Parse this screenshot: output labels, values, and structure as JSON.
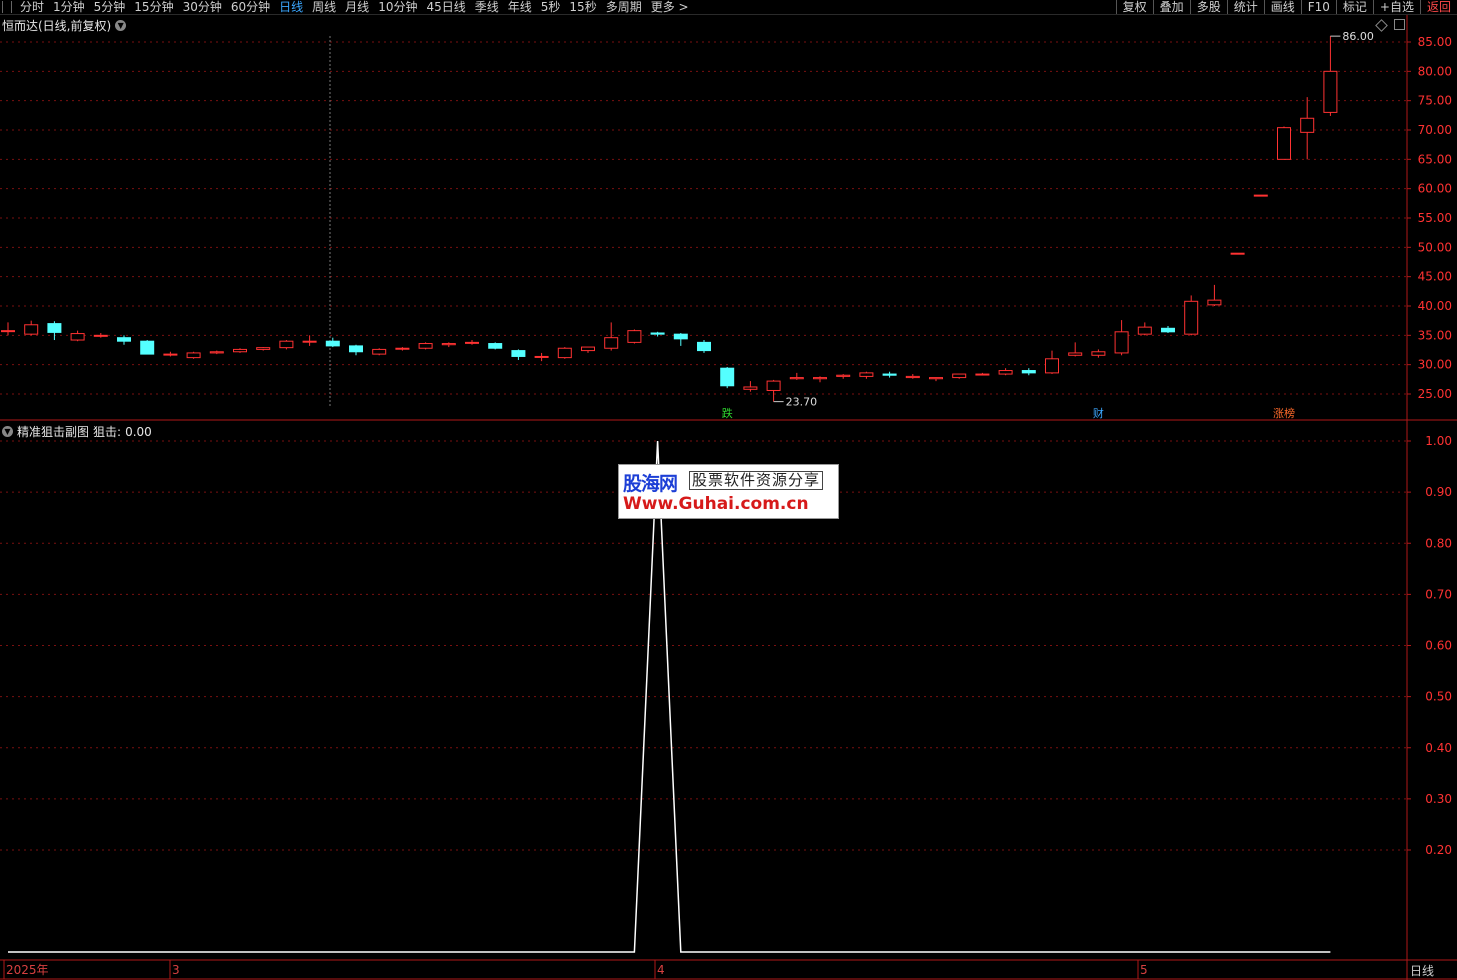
{
  "toolbar": {
    "periods": [
      "分时",
      "1分钟",
      "5分钟",
      "15分钟",
      "30分钟",
      "60分钟",
      "日线",
      "周线",
      "月线",
      "10分钟",
      "45日线",
      "季线",
      "年线",
      "5秒",
      "15秒",
      "多周期",
      "更多 >"
    ],
    "active_period": "日线",
    "right_buttons": [
      "复权",
      "叠加",
      "多股",
      "统计",
      "画线",
      "F10",
      "标记",
      "+自选",
      "返回"
    ]
  },
  "main_chart": {
    "title": "恒而达(日线,前复权)",
    "price_axis": [
      "85.00",
      "80.00",
      "75.00",
      "70.00",
      "65.00",
      "60.00",
      "55.00",
      "50.00",
      "45.00",
      "40.00",
      "35.00",
      "30.00",
      "25.00"
    ],
    "high_label": "86.00",
    "low_label": "23.70",
    "markers": [
      {
        "text": "跌",
        "color": "#2fd62f"
      },
      {
        "text": "财",
        "color": "#3ba7ff"
      },
      {
        "text": "涨榜",
        "color": "#ff6a2a"
      }
    ]
  },
  "sub_chart": {
    "title": "精准狙击副图",
    "series_label": "狙击:",
    "series_value": "0.00",
    "value_axis": [
      "1.00",
      "0.90",
      "0.80",
      "0.70",
      "0.60",
      "0.50",
      "0.40",
      "0.30",
      "0.20"
    ]
  },
  "time_axis": {
    "labels": [
      "2025年",
      "3",
      "4",
      "5"
    ]
  },
  "period_badge": "日线",
  "watermark": {
    "brand": "股海网",
    "tagline": "股票软件资源分享",
    "url": "Www.Guhai.com.cn"
  },
  "colors": {
    "up": "#ff3232",
    "down": "#54ffff",
    "grid": "#7a1010",
    "axis": "#b01818",
    "line": "#ffffff"
  },
  "chart_data": [
    {
      "type": "candlestick",
      "title": "恒而达(日线,前复权)",
      "ylim": [
        21.5,
        88
      ],
      "candles": [
        {
          "o": 35.8,
          "h": 37.2,
          "l": 35.0,
          "c": 35.8
        },
        {
          "o": 35.2,
          "h": 37.5,
          "l": 35.0,
          "c": 36.8
        },
        {
          "o": 37.0,
          "h": 37.4,
          "l": 34.2,
          "c": 35.5
        },
        {
          "o": 34.2,
          "h": 35.8,
          "l": 34.0,
          "c": 35.3
        },
        {
          "o": 35.0,
          "h": 35.4,
          "l": 34.6,
          "c": 35.0
        },
        {
          "o": 34.6,
          "h": 35.0,
          "l": 33.4,
          "c": 34.0
        },
        {
          "o": 34.0,
          "h": 34.2,
          "l": 31.8,
          "c": 31.8
        },
        {
          "o": 31.8,
          "h": 32.2,
          "l": 31.4,
          "c": 31.8
        },
        {
          "o": 31.2,
          "h": 32.2,
          "l": 31.0,
          "c": 32.0
        },
        {
          "o": 32.0,
          "h": 32.4,
          "l": 31.8,
          "c": 32.2
        },
        {
          "o": 32.2,
          "h": 32.8,
          "l": 32.0,
          "c": 32.6
        },
        {
          "o": 32.6,
          "h": 33.0,
          "l": 32.4,
          "c": 32.9
        },
        {
          "o": 32.9,
          "h": 34.2,
          "l": 32.6,
          "c": 34.0
        },
        {
          "o": 34.0,
          "h": 35.0,
          "l": 33.2,
          "c": 34.0
        },
        {
          "o": 34.0,
          "h": 34.6,
          "l": 33.0,
          "c": 33.2
        },
        {
          "o": 33.2,
          "h": 33.4,
          "l": 31.6,
          "c": 32.2
        },
        {
          "o": 31.8,
          "h": 32.8,
          "l": 31.6,
          "c": 32.6
        },
        {
          "o": 32.8,
          "h": 33.0,
          "l": 32.4,
          "c": 32.8
        },
        {
          "o": 32.8,
          "h": 33.8,
          "l": 32.6,
          "c": 33.6
        },
        {
          "o": 33.4,
          "h": 33.8,
          "l": 33.0,
          "c": 33.6
        },
        {
          "o": 33.8,
          "h": 34.2,
          "l": 33.4,
          "c": 33.8
        },
        {
          "o": 33.6,
          "h": 33.8,
          "l": 32.6,
          "c": 32.8
        },
        {
          "o": 32.4,
          "h": 32.6,
          "l": 30.8,
          "c": 31.4
        },
        {
          "o": 31.4,
          "h": 32.0,
          "l": 30.6,
          "c": 31.4
        },
        {
          "o": 31.2,
          "h": 33.0,
          "l": 31.0,
          "c": 32.8
        },
        {
          "o": 32.4,
          "h": 33.0,
          "l": 32.0,
          "c": 33.0
        },
        {
          "o": 32.8,
          "h": 37.2,
          "l": 32.4,
          "c": 34.6
        },
        {
          "o": 33.8,
          "h": 36.0,
          "l": 33.6,
          "c": 35.8
        },
        {
          "o": 35.4,
          "h": 35.6,
          "l": 34.8,
          "c": 35.2
        },
        {
          "o": 35.2,
          "h": 35.4,
          "l": 33.2,
          "c": 34.4
        },
        {
          "o": 33.8,
          "h": 34.2,
          "l": 32.0,
          "c": 32.4
        },
        {
          "o": 29.4,
          "h": 29.6,
          "l": 26.0,
          "c": 26.4
        },
        {
          "o": 25.8,
          "h": 27.2,
          "l": 25.4,
          "c": 26.2
        },
        {
          "o": 25.6,
          "h": 27.4,
          "l": 23.7,
          "c": 27.2
        },
        {
          "o": 27.6,
          "h": 28.6,
          "l": 27.4,
          "c": 27.8
        },
        {
          "o": 27.6,
          "h": 28.0,
          "l": 27.0,
          "c": 27.8
        },
        {
          "o": 28.0,
          "h": 28.4,
          "l": 27.6,
          "c": 28.2
        },
        {
          "o": 28.0,
          "h": 28.8,
          "l": 27.6,
          "c": 28.6
        },
        {
          "o": 28.4,
          "h": 28.8,
          "l": 27.8,
          "c": 28.2
        },
        {
          "o": 27.8,
          "h": 28.4,
          "l": 27.6,
          "c": 28.0
        },
        {
          "o": 27.6,
          "h": 27.8,
          "l": 27.2,
          "c": 27.8
        },
        {
          "o": 27.8,
          "h": 28.4,
          "l": 27.6,
          "c": 28.4
        },
        {
          "o": 28.4,
          "h": 28.6,
          "l": 28.2,
          "c": 28.4
        },
        {
          "o": 28.4,
          "h": 29.4,
          "l": 28.2,
          "c": 29.0
        },
        {
          "o": 29.0,
          "h": 29.4,
          "l": 28.2,
          "c": 28.6
        },
        {
          "o": 28.6,
          "h": 32.4,
          "l": 28.4,
          "c": 31.0
        },
        {
          "o": 31.6,
          "h": 33.8,
          "l": 31.4,
          "c": 32.0
        },
        {
          "o": 31.6,
          "h": 32.6,
          "l": 31.2,
          "c": 32.2
        },
        {
          "o": 32.0,
          "h": 37.6,
          "l": 31.6,
          "c": 35.6
        },
        {
          "o": 35.2,
          "h": 37.2,
          "l": 35.0,
          "c": 36.4
        },
        {
          "o": 36.2,
          "h": 36.6,
          "l": 35.4,
          "c": 35.6
        },
        {
          "o": 35.2,
          "h": 41.8,
          "l": 35.0,
          "c": 40.8
        },
        {
          "o": 40.2,
          "h": 43.6,
          "l": 40.0,
          "c": 41.0
        },
        {
          "o": 49.0,
          "h": 49.0,
          "l": 49.0,
          "c": 49.0
        },
        {
          "o": 58.9,
          "h": 58.9,
          "l": 58.9,
          "c": 58.9
        },
        {
          "o": 65.0,
          "h": 70.6,
          "l": 65.0,
          "c": 70.4
        },
        {
          "o": 69.6,
          "h": 75.6,
          "l": 65.0,
          "c": 72.0
        },
        {
          "o": 73.0,
          "h": 86.0,
          "l": 72.4,
          "c": 80.0
        }
      ]
    },
    {
      "type": "line",
      "title": "精准狙击副图",
      "series": [
        {
          "name": "狙击",
          "values_note": "flat 0 with single spike to 1.00 around April start"
        }
      ],
      "ylim": [
        0,
        1.0
      ],
      "points": [
        {
          "i": 0,
          "v": 0
        },
        {
          "i": 27,
          "v": 0
        },
        {
          "i": 28,
          "v": 1.0
        },
        {
          "i": 29,
          "v": 0
        },
        {
          "i": 57,
          "v": 0
        }
      ]
    }
  ]
}
